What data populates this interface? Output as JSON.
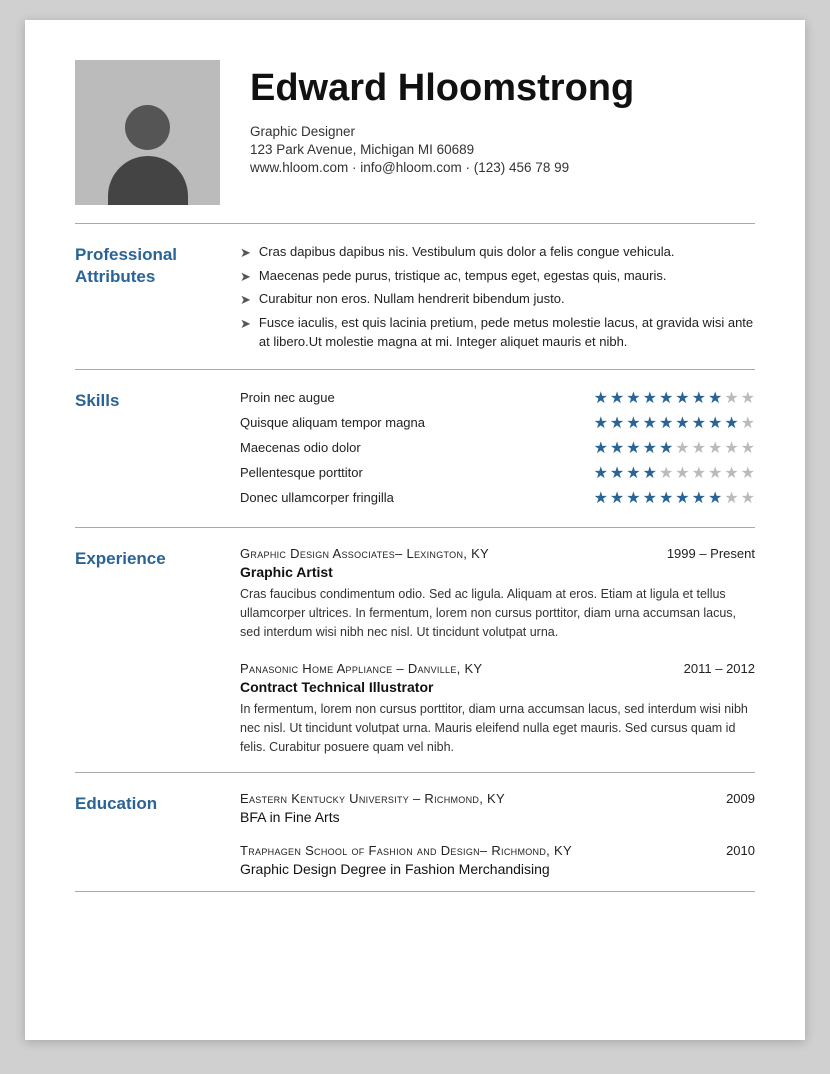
{
  "header": {
    "name": "Edward Hloomstrong",
    "title": "Graphic Designer",
    "address": "123 Park Avenue, Michigan MI 60689",
    "contact": "www.hloom.com · info@hloom.com · (123) 456 78 99"
  },
  "sections": {
    "professional": {
      "label": "Professional\nAttributes",
      "attributes": [
        "Cras dapibus dapibus nis. Vestibulum quis dolor a felis congue vehicula.",
        "Maecenas pede purus, tristique ac, tempus eget, egestas quis, mauris.",
        "Curabitur non eros. Nullam hendrerit bibendum justo.",
        "Fusce iaculis, est quis lacinia pretium, pede metus molestie lacus, at gravida wisi ante at libero.Ut molestie magna at mi. Integer aliquet mauris et nibh."
      ]
    },
    "skills": {
      "label": "Skills",
      "items": [
        {
          "name": "Proin nec augue",
          "filled": 8,
          "empty": 2
        },
        {
          "name": "Quisque aliquam tempor magna",
          "filled": 9,
          "empty": 1
        },
        {
          "name": "Maecenas odio dolor",
          "filled": 5,
          "empty": 5
        },
        {
          "name": "Pellentesque porttitor",
          "filled": 4,
          "empty": 6
        },
        {
          "name": "Donec ullamcorper fringilla",
          "filled": 8,
          "empty": 2
        }
      ]
    },
    "experience": {
      "label": "Experience",
      "entries": [
        {
          "company": "Graphic Design Associates– Lexington, KY",
          "dates": "1999 – Present",
          "title": "Graphic Artist",
          "desc": "Cras faucibus condimentum odio. Sed ac ligula. Aliquam at eros. Etiam at ligula et tellus ullamcorper ultrices. In fermentum, lorem non cursus porttitor, diam urna accumsan lacus, sed interdum wisi nibh nec nisl. Ut tincidunt volutpat urna."
        },
        {
          "company": "Panasonic Home Appliance – Danville, KY",
          "dates": "2011 – 2012",
          "title": "Contract Technical Illustrator",
          "desc": "In fermentum, lorem non cursus porttitor, diam urna accumsan lacus, sed interdum wisi nibh nec nisl. Ut tincidunt volutpat urna. Mauris eleifend nulla eget mauris. Sed cursus quam id felis. Curabitur posuere quam vel nibh."
        }
      ]
    },
    "education": {
      "label": "Education",
      "entries": [
        {
          "institution": "Eastern Kentucky University – Richmond, KY",
          "year": "2009",
          "degree": "BFA in Fine Arts"
        },
        {
          "institution": "Traphagen School of Fashion and Design– Richmond, KY",
          "year": "2010",
          "degree": "Graphic Design Degree in Fashion Merchandising"
        }
      ]
    }
  }
}
